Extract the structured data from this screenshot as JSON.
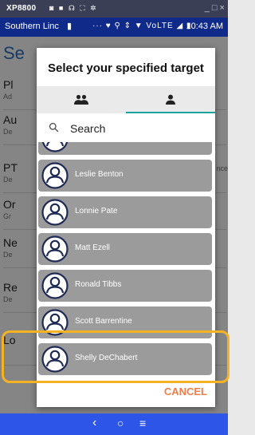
{
  "window": {
    "title": "XP8800",
    "icons": "◙ ■ ☊ ⛶ ✲",
    "controls": "_ □ ×"
  },
  "status_bar": {
    "carrier": "Southern Linc",
    "sim_icon": "▮",
    "icons": "··· ♥ ⚲ ⇕ ▼ VoLTE ◢ ▮",
    "time": "10:43 AM"
  },
  "background_app": {
    "title": "Se",
    "items": [
      {
        "title": "Pl",
        "subtitle": "Ad"
      },
      {
        "title": "Au",
        "subtitle": "De"
      },
      {
        "title": "PT",
        "subtitle": "De"
      },
      {
        "title": "Or",
        "subtitle": "Gr"
      },
      {
        "title": "Ne",
        "subtitle": "De"
      },
      {
        "title": "Re",
        "subtitle": "De"
      },
      {
        "title": "Lo",
        "subtitle": ""
      }
    ],
    "right_fragment": "nce"
  },
  "dialog": {
    "title": "Select your specified target",
    "tabs": [
      {
        "icon": "group-icon",
        "selected": false
      },
      {
        "icon": "person-icon",
        "selected": true
      }
    ],
    "search_placeholder": "Search",
    "contacts": [
      {
        "name": ""
      },
      {
        "name": "Leslie Benton"
      },
      {
        "name": "Lonnie Pate"
      },
      {
        "name": "Matt Ezell"
      },
      {
        "name": "Ronald Tibbs"
      },
      {
        "name": "Scott Barrentine"
      },
      {
        "name": "Shelly DeChabert"
      }
    ],
    "cancel_label": "CANCEL"
  },
  "nav_bar": {
    "back": "‹",
    "home": "○",
    "recent": "≡"
  },
  "colors": {
    "status_bar": "#102a8a",
    "nav_bar": "#2d55e8",
    "tab_indicator": "#1aa39a",
    "contact_row": "#9b9b9b",
    "cancel": "#f07d4a",
    "highlight": "#f5b324"
  }
}
